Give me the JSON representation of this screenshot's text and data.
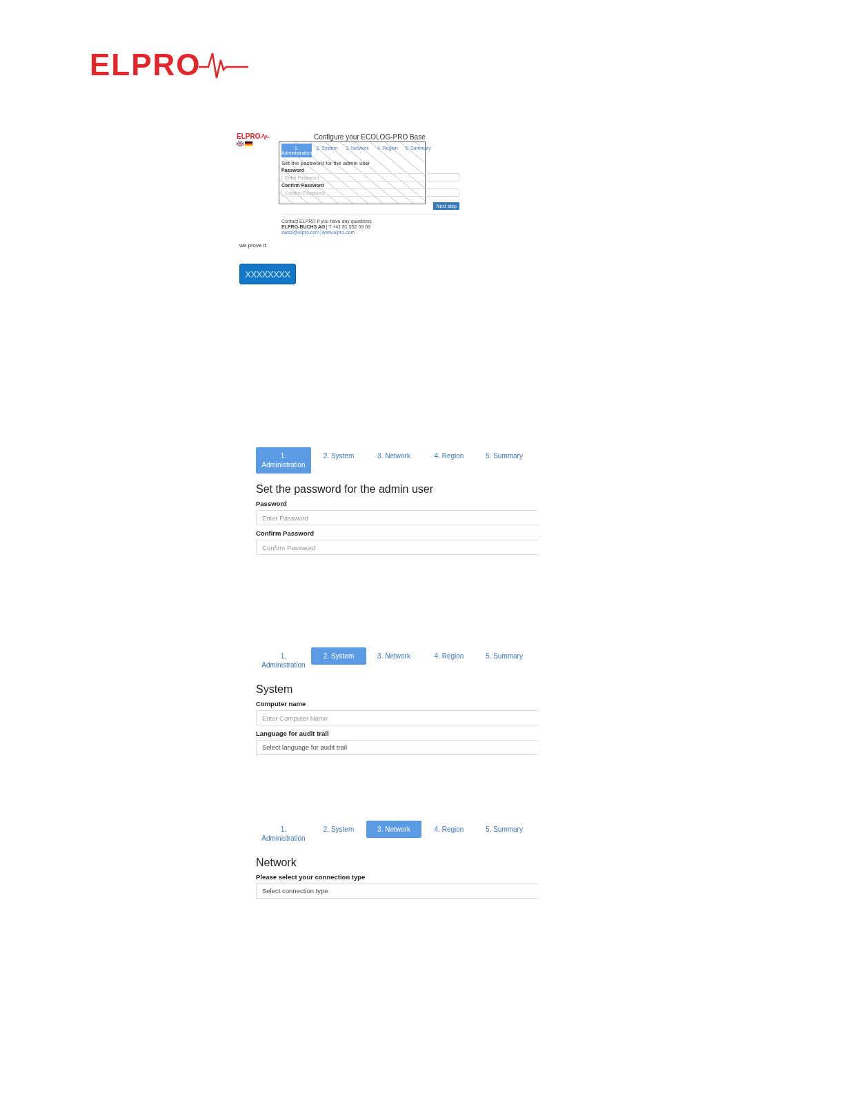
{
  "logo": {
    "text": "ELPRO"
  },
  "overview": {
    "logo": "ELPRO",
    "title": "Configure your ECOLOG-PRO Base",
    "steps": [
      {
        "label": "1. Administration",
        "selected": true
      },
      {
        "label": "2. System",
        "selected": false
      },
      {
        "label": "3. Network",
        "selected": false
      },
      {
        "label": "4. Region",
        "selected": false
      },
      {
        "label": "5. Summary",
        "selected": false
      }
    ],
    "heading": "Set the password for the admin user",
    "fields": [
      {
        "kind": "input",
        "label": "Password",
        "placeholder": "Enter Password"
      },
      {
        "kind": "input",
        "label": "Confirm Password",
        "placeholder": "Confirm Password"
      }
    ],
    "next_button": "Next step",
    "contact": {
      "intro": "Contact ELPRO if you have any questions",
      "company": "ELPRO-BUCHS AG",
      "phone": "| T +41 81 552 09 09",
      "email": "swiss@elpro.com",
      "separator": "|",
      "website": "www.elpro.com"
    }
  },
  "tagline": "we prove it.",
  "button": "XXXXXXXX",
  "screens": [
    {
      "steps": [
        {
          "label": "1. Administration",
          "selected": true
        },
        {
          "label": "2. System",
          "selected": false
        },
        {
          "label": "3. Network",
          "selected": false
        },
        {
          "label": "4. Region",
          "selected": false
        },
        {
          "label": "5. Summary",
          "selected": false
        }
      ],
      "heading": "Set the password for the admin user",
      "fields": [
        {
          "kind": "input",
          "label": "Password",
          "placeholder": "Enter Password"
        },
        {
          "kind": "input",
          "label": "Confirm Password",
          "placeholder": "Confirm Password"
        }
      ]
    },
    {
      "steps": [
        {
          "label": "1. Administration",
          "selected": false
        },
        {
          "label": "2. System",
          "selected": true
        },
        {
          "label": "3. Network",
          "selected": false
        },
        {
          "label": "4. Region",
          "selected": false
        },
        {
          "label": "5. Summary",
          "selected": false
        }
      ],
      "heading": "System",
      "fields": [
        {
          "kind": "input",
          "label": "Computer name",
          "placeholder": "Enter Computer Name"
        },
        {
          "kind": "select",
          "label": "Language for audit trail",
          "value": "Select language for audit trail"
        }
      ]
    },
    {
      "steps": [
        {
          "label": "1. Administration",
          "selected": false
        },
        {
          "label": "2. System",
          "selected": false
        },
        {
          "label": "3. Network",
          "selected": true
        },
        {
          "label": "4. Region",
          "selected": false
        },
        {
          "label": "5. Summary",
          "selected": false
        }
      ],
      "heading": "Network",
      "fields": [
        {
          "kind": "select",
          "label": "Please select your connection type",
          "value": "Select connection type"
        }
      ]
    }
  ]
}
